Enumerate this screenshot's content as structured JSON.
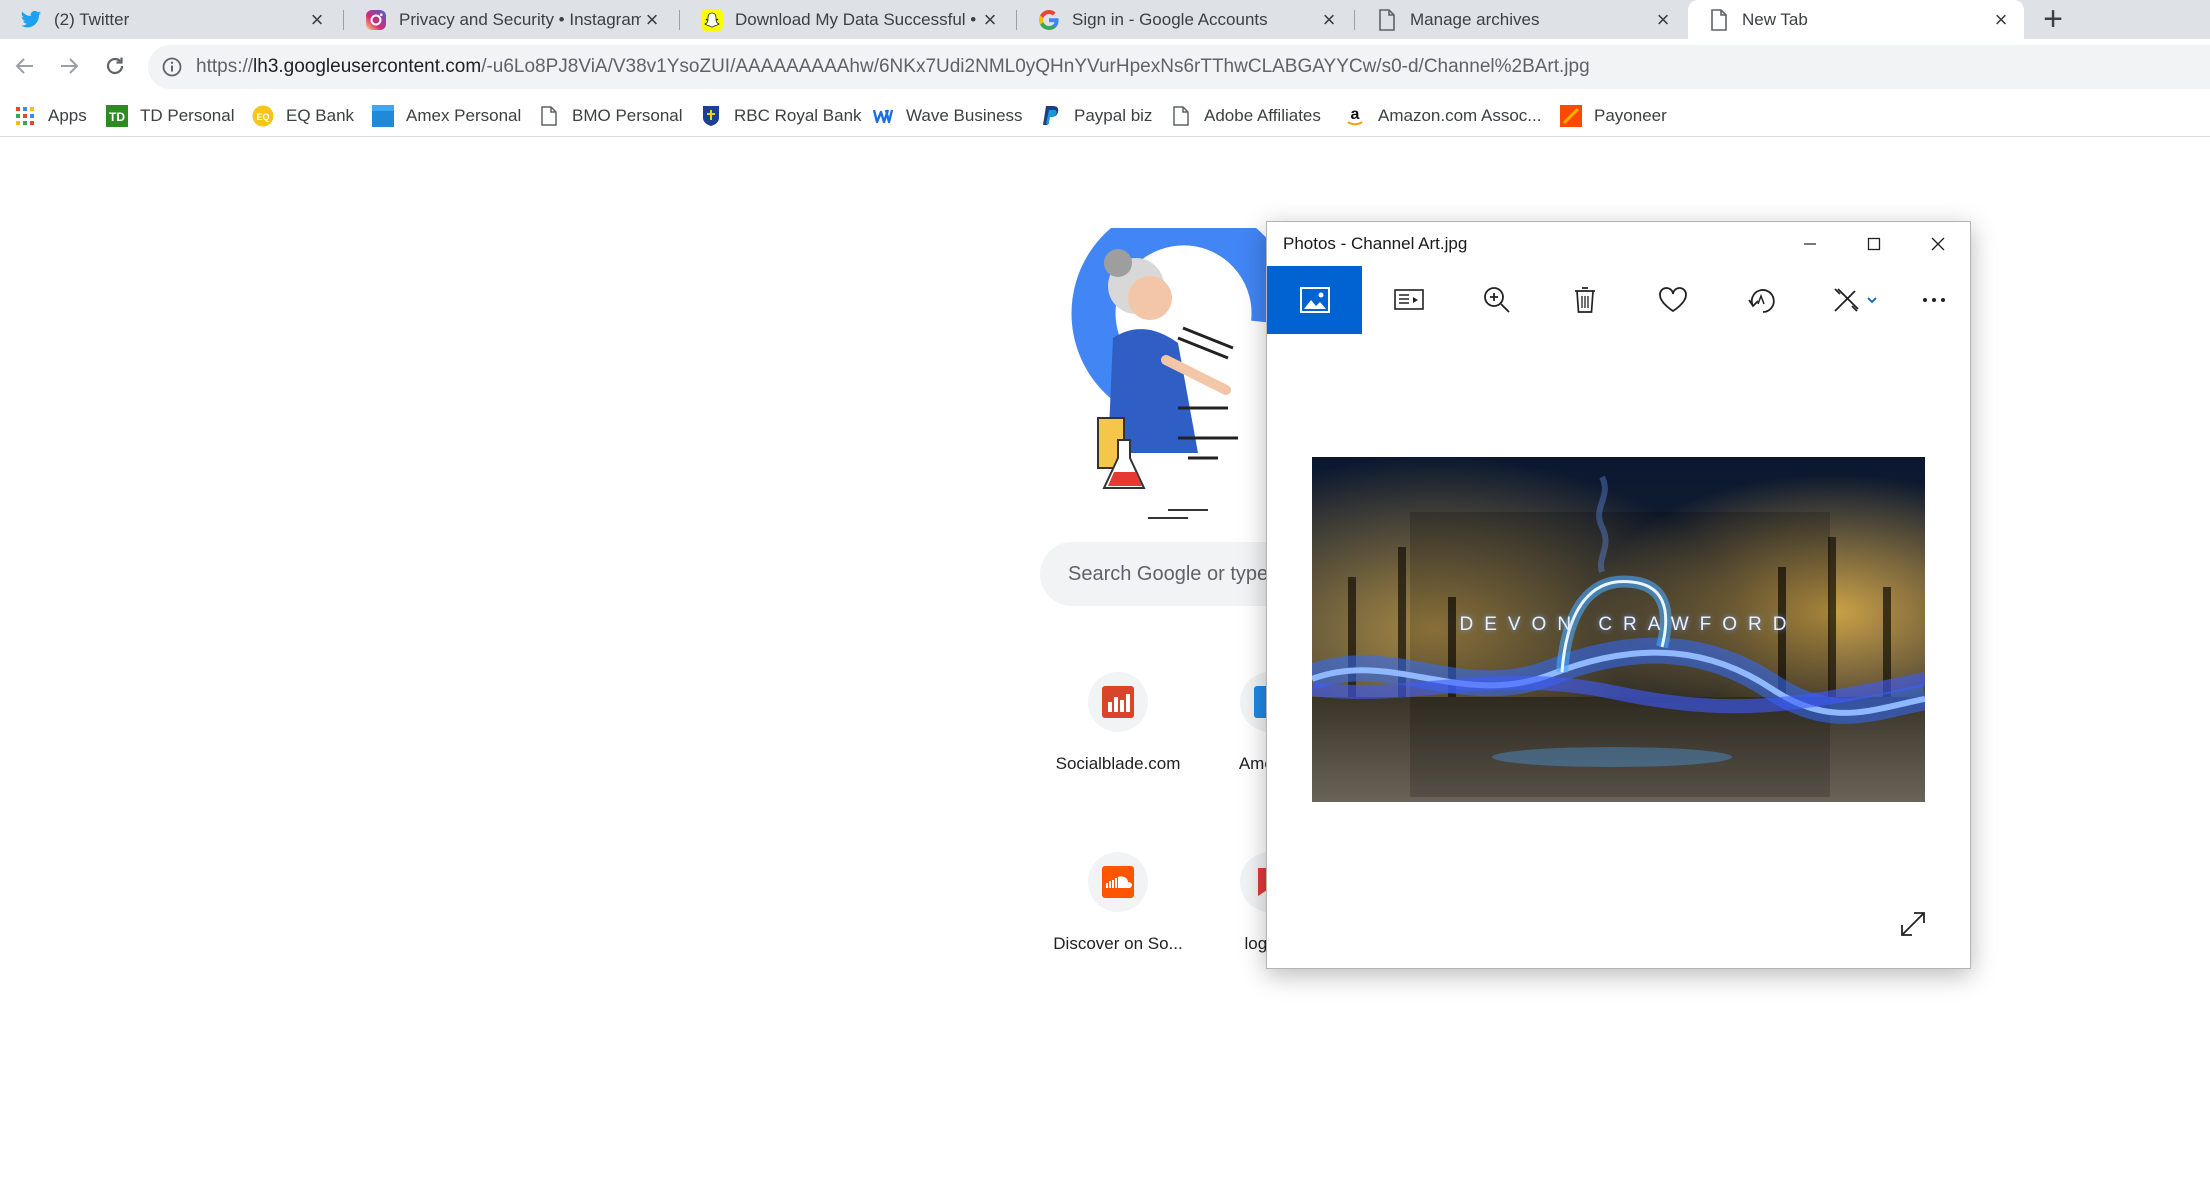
{
  "browser": {
    "tabs": [
      {
        "title": "(2) Twitter",
        "icon": "twitter-icon"
      },
      {
        "title": "Privacy and Security • Instagram",
        "icon": "instagram-icon"
      },
      {
        "title": "Download My Data Successful • ",
        "icon": "snapchat-icon"
      },
      {
        "title": "Sign in - Google Accounts",
        "icon": "google-icon"
      },
      {
        "title": "Manage archives",
        "icon": "page-icon"
      },
      {
        "title": "New Tab",
        "icon": "page-icon",
        "active": true
      }
    ],
    "url": {
      "scheme": "https://",
      "host": "lh3.googleusercontent.com",
      "path": "/-u6Lo8PJ8ViA/V38v1YsoZUI/AAAAAAAAAhw/6NKx7Udi2NML0yQHnYVurHpexNs6rTThwCLABGAYYCw/s0-d/Channel%2BArt.jpg"
    },
    "bookmarks": [
      {
        "label": "Apps",
        "icon": "apps-grid-icon"
      },
      {
        "label": "TD Personal",
        "icon": "td-icon"
      },
      {
        "label": "EQ Bank",
        "icon": "eq-bank-icon"
      },
      {
        "label": "Amex Personal",
        "icon": "amex-icon"
      },
      {
        "label": "BMO Personal",
        "icon": "page-icon"
      },
      {
        "label": "RBC Royal Bank",
        "icon": "rbc-icon"
      },
      {
        "label": "Wave Business",
        "icon": "wave-icon"
      },
      {
        "label": "Paypal biz",
        "icon": "paypal-icon"
      },
      {
        "label": "Adobe Affiliates",
        "icon": "page-icon"
      },
      {
        "label": "Amazon.com Assoc...",
        "icon": "amazon-icon"
      },
      {
        "label": "Payoneer",
        "icon": "payoneer-icon"
      }
    ]
  },
  "newtab": {
    "search_placeholder": "Search Google or type",
    "shortcuts": [
      {
        "label": "Socialblade.com",
        "icon": "socialblade-icon"
      },
      {
        "label": "America",
        "icon": "site-icon"
      },
      {
        "label": "Discover on So...",
        "icon": "soundcloud-icon"
      },
      {
        "label": "login.tr",
        "icon": "site-icon"
      }
    ]
  },
  "photos_app": {
    "title": "Photos - Channel Art.jpg",
    "image_text": "DEVON CRAWFORD",
    "toolbar": [
      "view-image-icon",
      "slideshow-icon",
      "zoom-icon",
      "delete-icon",
      "favorite-icon",
      "rotate-icon",
      "edit-create-icon",
      "more-icon"
    ]
  },
  "colors": {
    "tabstrip": "#dee1e6",
    "photos_accent": "#0063d1",
    "omnibox": "#f1f3f4"
  }
}
